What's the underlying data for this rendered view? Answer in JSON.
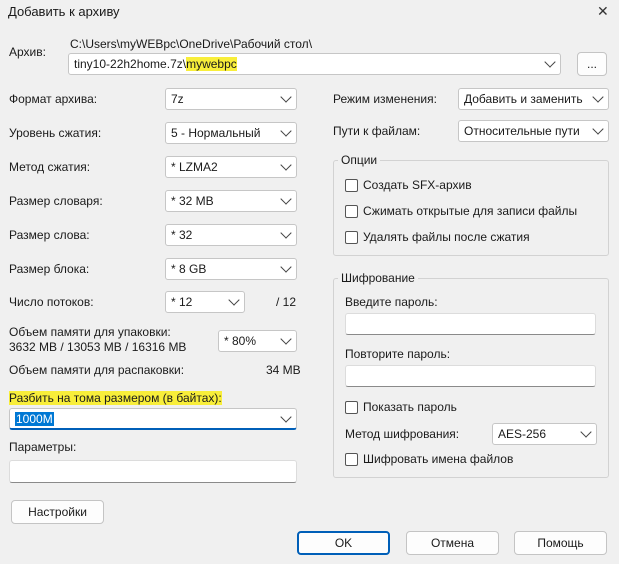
{
  "window": {
    "title": "Добавить к архиву",
    "close_glyph": "✕"
  },
  "archive": {
    "label": "Архив:",
    "path": "C:\\Users\\myWEBpc\\OneDrive\\Рабочий стол\\",
    "filename_prefix": "tiny10-22h2home.7z\\",
    "filename_highlight": "mywebpc",
    "browse_label": "..."
  },
  "left": {
    "format": {
      "label": "Формат архива:",
      "value": "7z"
    },
    "level": {
      "label": "Уровень сжатия:",
      "value": "5 - Нормальный"
    },
    "method": {
      "label": "Метод сжатия:",
      "value": "*  LZMA2"
    },
    "dict": {
      "label": "Размер словаря:",
      "value": "*  32 MB"
    },
    "word": {
      "label": "Размер слова:",
      "value": "*  32"
    },
    "block": {
      "label": "Размер блока:",
      "value": "*  8 GB"
    },
    "threads": {
      "label": "Число потоков:",
      "value": "*  12",
      "max": "/ 12"
    },
    "mem_pack": {
      "label": "Объем памяти для упаковки:",
      "values": "3632 MB / 13053 MB / 16316 MB",
      "percent": "*  80%"
    },
    "mem_unpack": {
      "label": "Объем памяти для распаковки:",
      "value": "34 MB"
    },
    "split": {
      "label": "Разбить на тома размером (в байтах):",
      "value": "1000M"
    },
    "params": {
      "label": "Параметры:",
      "value": ""
    },
    "settings_button": "Настройки"
  },
  "right": {
    "update_mode": {
      "label": "Режим изменения:",
      "value": "Добавить и заменить"
    },
    "path_mode": {
      "label": "Пути к файлам:",
      "value": "Относительные пути"
    },
    "options": {
      "title": "Опции",
      "sfx": "Создать SFX-архив",
      "shared": "Сжимать открытые для записи файлы",
      "delete": "Удалять файлы после сжатия"
    },
    "encryption": {
      "title": "Шифрование",
      "password_label": "Введите пароль:",
      "repeat_label": "Повторите пароль:",
      "show_password": "Показать пароль",
      "method_label": "Метод шифрования:",
      "method_value": "AES-256",
      "encrypt_names": "Шифровать имена файлов"
    }
  },
  "buttons": {
    "ok": "OK",
    "cancel": "Отмена",
    "help": "Помощь"
  },
  "colors": {
    "highlight": "#f8ee3a",
    "accent": "#005fb8",
    "selection": "#0078d4"
  }
}
